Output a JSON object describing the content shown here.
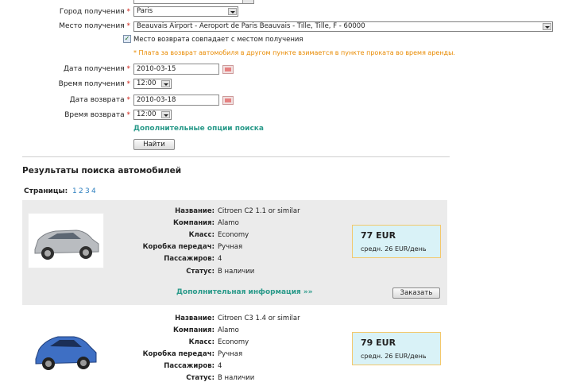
{
  "form": {
    "pickup_city_label": "Город получения",
    "pickup_city_value": "Paris",
    "pickup_place_label": "Место получения",
    "pickup_place_value": "Beauvais Airport - Aeroport de Paris Beauvais - Tille, Tille, F - 60000",
    "same_return_label": "Место возврата совпадает с местом получения",
    "same_return_checked": "✓",
    "fee_note": "* Плата за возврат автомобиля в другом пункте взимается в пункте проката во время аренды.",
    "pickup_date_label": "Дата получения",
    "pickup_date_value": "2010-03-15",
    "pickup_time_label": "Время получения",
    "pickup_time_value": "12:00",
    "return_date_label": "Дата возврата",
    "return_date_value": "2010-03-18",
    "return_time_label": "Время возврата",
    "return_time_value": "12:00",
    "extra_options_link": "Дополнительные опции поиска",
    "find_button": "Найти",
    "required_mark": "*"
  },
  "results": {
    "title": "Результаты поиска автомобилей",
    "pages_label": "Страницы:",
    "pages": [
      "1",
      "2",
      "3",
      "4"
    ],
    "field_labels": {
      "name": "Название:",
      "company": "Компания:",
      "class": "Класс:",
      "gearbox": "Коробка передач:",
      "passengers": "Пассажиров:",
      "status": "Статус:"
    },
    "cars": [
      {
        "name": "Citroen C2 1.1 or similar",
        "company": "Alamo",
        "class": "Economy",
        "gearbox": "Ручная",
        "passengers": "4",
        "status": "В наличии",
        "price": "77 EUR",
        "avg": "средн. 26 EUR/день",
        "more_info": "Дополнительная информация »»",
        "order_button": "Заказать",
        "car_color": "#b9bcc0"
      },
      {
        "name": "Citroen C3 1.4 or similar",
        "company": "Alamo",
        "class": "Economy",
        "gearbox": "Ручная",
        "passengers": "4",
        "status": "В наличии",
        "price": "79 EUR",
        "avg": "средн. 26 EUR/день",
        "car_color": "#3e6fc4"
      }
    ]
  },
  "colors": {
    "link": "#2a9a8a",
    "required": "#d0251b",
    "note": "#e88a00",
    "price_bg": "#d9f2f7",
    "price_border": "#f3c86b"
  }
}
